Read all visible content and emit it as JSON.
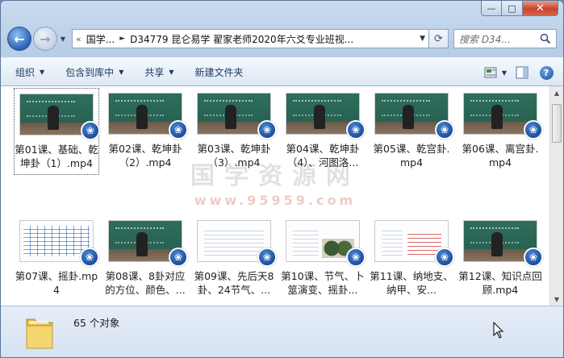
{
  "window": {
    "controls": {
      "minimize": "—",
      "maximize": "□",
      "close": "✕"
    }
  },
  "address_bar": {
    "prefix": "«",
    "segments": [
      "国学...",
      "D34779 昆仑易学 翟家老师2020年六爻专业班视..."
    ],
    "search_placeholder": "搜索 D34..."
  },
  "toolbar": {
    "items": [
      {
        "label": "组织",
        "has_menu": true
      },
      {
        "label": "包含到库中",
        "has_menu": true
      },
      {
        "label": "共享",
        "has_menu": true
      },
      {
        "label": "新建文件夹",
        "has_menu": false
      }
    ],
    "help": "?"
  },
  "watermark": {
    "line1": "国学资源网",
    "line2": "www.95959.com"
  },
  "files": [
    {
      "label": "第01课、基础、乾坤卦（1）.mp4",
      "thumb": "board",
      "selected": true
    },
    {
      "label": "第02课、乾坤卦（2）.mp4",
      "thumb": "board"
    },
    {
      "label": "第03课、乾坤卦（3）.mp4",
      "thumb": "board"
    },
    {
      "label": "第04课、乾坤卦（4）、河图洛...",
      "thumb": "board"
    },
    {
      "label": "第05课、乾宫卦.mp4",
      "thumb": "board"
    },
    {
      "label": "第06课、离宫卦.mp4",
      "thumb": "board"
    },
    {
      "label": "第07课、摇卦.mp4",
      "thumb": "table"
    },
    {
      "label": "第08课、8卦对应的方位、颜色、...",
      "thumb": "board"
    },
    {
      "label": "第09课、先后天8卦、24节气、...",
      "thumb": "doc"
    },
    {
      "label": "第10课、节气、卜筮演变、摇卦...",
      "thumb": "photo"
    },
    {
      "label": "第11课、纳地支、纳甲、安...",
      "thumb": "red"
    },
    {
      "label": "第12课、知识点回顾.mp4",
      "thumb": "board"
    }
  ],
  "status": {
    "count_text": "65 个对象"
  },
  "colors": {
    "accent": "#1d4f9a",
    "toolbar_text": "#1e395b"
  }
}
